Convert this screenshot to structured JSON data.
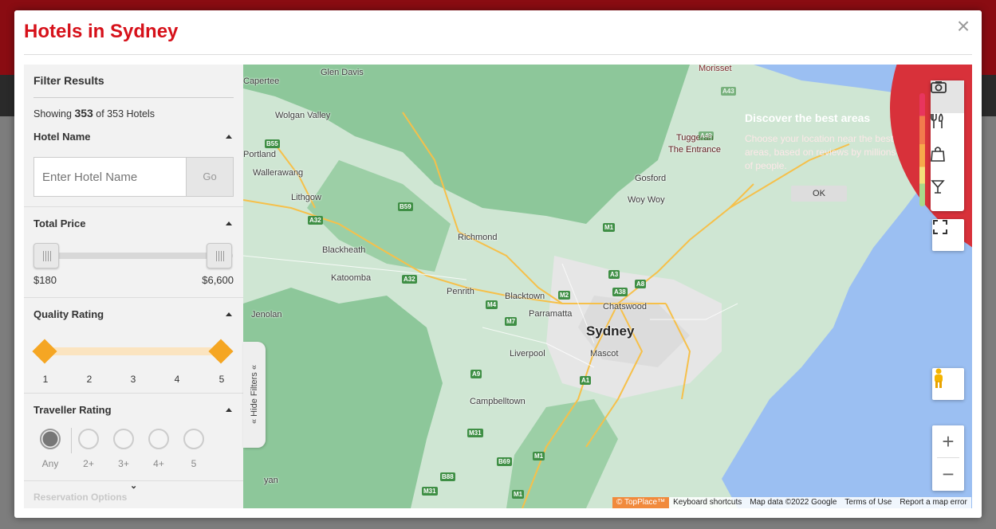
{
  "modal": {
    "title": "Hotels in Sydney",
    "close_label": "×"
  },
  "filters": {
    "title": "Filter Results",
    "showing_prefix": "Showing",
    "showing_count": "353",
    "showing_suffix": "of 353 Hotels",
    "hotel_name": {
      "heading": "Hotel Name",
      "placeholder": "Enter Hotel Name",
      "go_label": "Go"
    },
    "total_price": {
      "heading": "Total Price",
      "min_label": "$180",
      "max_label": "$6,600"
    },
    "quality_rating": {
      "heading": "Quality Rating",
      "ticks": [
        "1",
        "2",
        "3",
        "4",
        "5"
      ],
      "selected_min": 1,
      "selected_max": 5
    },
    "traveller_rating": {
      "heading": "Traveller Rating",
      "options": [
        "Any",
        "2+",
        "3+",
        "4+",
        "5"
      ],
      "selected": "Any"
    },
    "reservation_options": {
      "heading": "Reservation Options"
    },
    "hide_filters_label": "Hide Filters"
  },
  "map": {
    "city_label": "Sydney",
    "place_labels": [
      "Glen Davis",
      "Capertee",
      "Wolgan Valley",
      "Portland",
      "Wallerawang",
      "Lithgow",
      "Blackheath",
      "Katoomba",
      "Jenolan",
      "Richmond",
      "Penrith",
      "Blacktown",
      "Parramatta",
      "Chatswood",
      "Mascot",
      "Liverpool",
      "Campbelltown",
      "Gosford",
      "Woy Woy",
      "Tuggerah",
      "The Entrance",
      "Morisset",
      "yan"
    ],
    "road_shields": [
      "B55",
      "B59",
      "A32",
      "A32",
      "M4",
      "M7",
      "M2",
      "A3",
      "A8",
      "A38",
      "M1",
      "A9",
      "A1",
      "M31",
      "B69",
      "M1",
      "B88",
      "M31",
      "M1",
      "A49",
      "A43"
    ],
    "discover": {
      "title": "Discover the best areas",
      "text": "Choose your location near the best areas, based on reviews by millions of people.",
      "ok_label": "OK"
    },
    "category_icons": [
      "camera-icon",
      "restaurant-icon",
      "shopping-bag-icon",
      "cocktail-icon"
    ],
    "heat_colors": [
      "#e8355e",
      "#f27a4d",
      "#f7a94b",
      "#f4e07a",
      "#a9d88a"
    ],
    "zoom_in_label": "+",
    "zoom_out_label": "−",
    "attribution": [
      "© TopPlace™",
      "Keyboard shortcuts",
      "Map data ©2022 Google",
      "Terms of Use",
      "Report a map error"
    ]
  },
  "colors": {
    "brand_red": "#d6111a",
    "rating_orange": "#f5a623"
  }
}
